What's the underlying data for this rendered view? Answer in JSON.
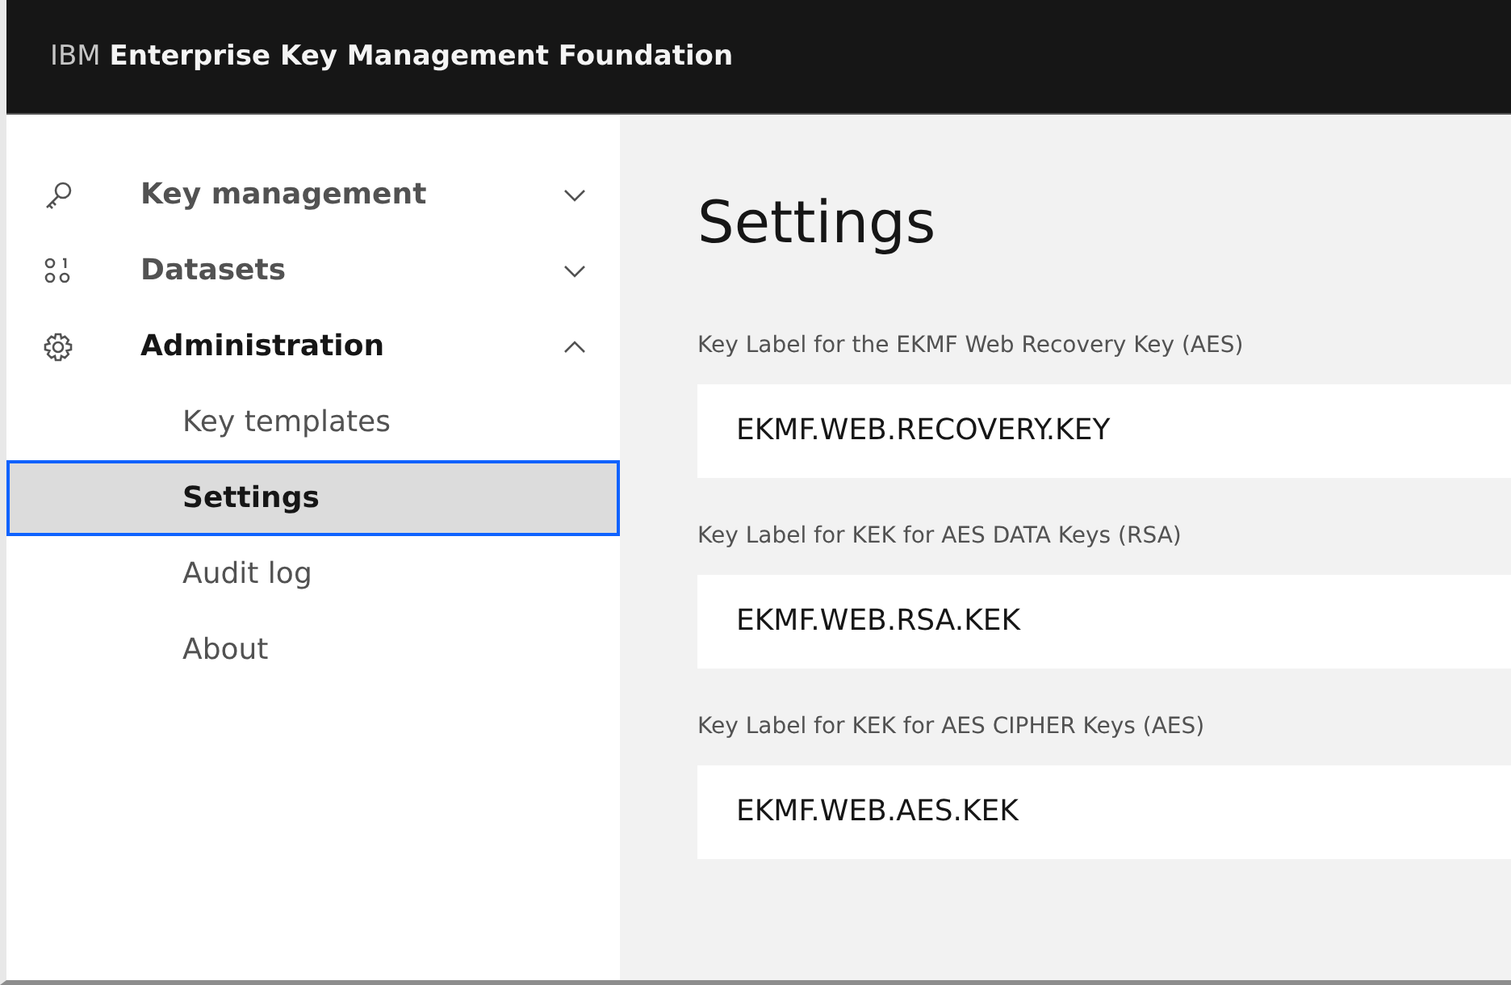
{
  "header": {
    "title": "IBM **Enterprise Key Management Foundation**"
  },
  "sidebar": {
    "items": [
      {
        "label": "Key management",
        "expanded": false
      },
      {
        "label": "Datasets",
        "expanded": false
      },
      {
        "label": "Administration",
        "expanded": true,
        "children": [
          {
            "label": "Key templates",
            "selected": false
          },
          {
            "label": "Settings",
            "selected": true
          },
          {
            "label": "Audit log",
            "selected": false
          },
          {
            "label": "About",
            "selected": false
          }
        ]
      }
    ]
  },
  "main": {
    "heading": "Settings",
    "fields": [
      {
        "label": "Key Label for the EKMF Web Recovery Key (AES)",
        "value": "EKMF.WEB.RECOVERY.KEY"
      },
      {
        "label": "Key Label for KEK for AES DATA Keys (RSA)",
        "value": "EKMF.WEB.RSA.KEK"
      },
      {
        "label": "Key Label for KEK for AES CIPHER Keys (AES)",
        "value": "EKMF.WEB.AES.KEK"
      }
    ]
  }
}
